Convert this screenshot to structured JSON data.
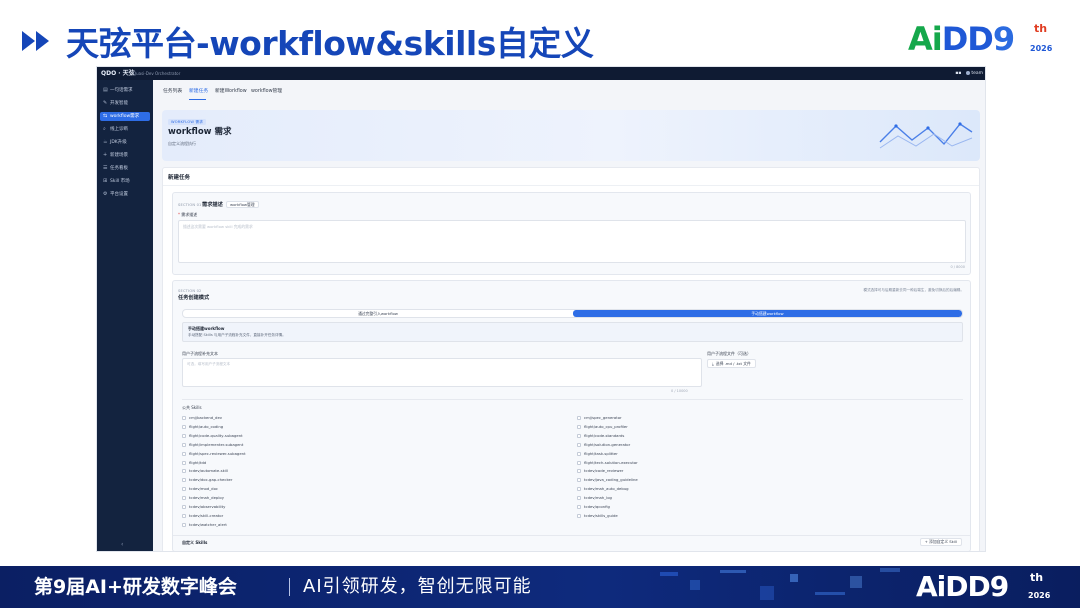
{
  "slide": {
    "title": "天弦平台-workflow&skills自定义",
    "logo": {
      "text_a": "Ai",
      "text_b": "DD",
      "nine": "9",
      "th": "th",
      "year": "2026"
    },
    "footer": {
      "title": "第9届AI+研发数字峰会",
      "slogan": "AI引领研发，智创无限可能"
    },
    "colors": {
      "title": "#1546b8",
      "accent": "#2e6de6",
      "footer_bg": "#0b1f63",
      "sidebar_bg": "#13233f"
    }
  },
  "app": {
    "brand": "QDO · 天弦",
    "brand_sub": "Quasi-Dev Orchestrator",
    "user": "team",
    "sidebar": {
      "items": [
        {
          "icon": "chat-icon",
          "glyph": "▤",
          "label": "一句话需求"
        },
        {
          "icon": "tools-icon",
          "glyph": "✎",
          "label": "开发智能"
        },
        {
          "icon": "workflow-icon",
          "glyph": "⇆",
          "label": "workflow需求"
        },
        {
          "icon": "search-icon",
          "glyph": "⌕",
          "label": "线上诊断"
        },
        {
          "icon": "jdk-icon",
          "glyph": "☕",
          "label": "JDK升级"
        },
        {
          "icon": "plus-icon",
          "glyph": "+",
          "label": "新建场景"
        },
        {
          "icon": "list-icon",
          "glyph": "☰",
          "label": "任务看板"
        },
        {
          "icon": "market-icon",
          "glyph": "⊞",
          "label": "Skill 市场"
        },
        {
          "icon": "settings-icon",
          "glyph": "⚙",
          "label": "平台设置"
        }
      ],
      "active_index": 2,
      "collapse": "‹"
    },
    "tabs": [
      "任务列表",
      "新建任务",
      "新建Workflow",
      "workflow管理"
    ],
    "active_tab": 1,
    "hero": {
      "badge": "WORKFLOW 需求",
      "title": "workflow 需求",
      "subtitle": "自定义流程执行"
    },
    "new_task": {
      "title": "新建任务",
      "section1": {
        "label": "SECTION 01",
        "title": "需求描述",
        "tag": "workflow管理",
        "field_required": "*",
        "field_label": "需求描述",
        "placeholder": "描述这次需要 workflow skill 完成的需求",
        "count": "0 / 8000"
      },
      "section2": {
        "label": "SECTION 02",
        "title": "任务创建模式",
        "hint": "模式选择可与后期重新去同一种后端生，避免切换后的后编辑。",
        "modes": [
          "通过完整引入workflow",
          "手动搭建workflow"
        ],
        "active_mode": 1,
        "info_title": "手动搭建workflow",
        "info_desc": "手动搭配 Skills 与用户子流程补充文件，直接补开任务详情。",
        "req_label": "用户子流程补充文本",
        "req_placeholder": "可选，填写用户子流程文本",
        "req_count": "0 / 10000",
        "file_label": "用户子流程文件（可选）",
        "file_icon": "upload-icon",
        "file_button": "选择 .md / .txt 文件",
        "skills_label": "公共 Skills",
        "skills_left": [
          "cmj/backend_dev",
          "flight/auto_coding",
          "flight/code-quality-subagent",
          "flight/implementer-subagent",
          "flight/spec-reviewer-subagent",
          "flight/tdd",
          "tcdev/automate-skill",
          "tcdev/doc-gap-checker",
          "tcdev/mod_doc",
          "tcdev/mah_deploy",
          "tcdev/observability",
          "tcdev/skill-creator",
          "tcdev/watcher_alert"
        ],
        "skills_right": [
          "cmj/spec_generator",
          "flight/auto_cpu_profiler",
          "flight/code-standards",
          "flight/solution-generator",
          "flight/task-splitter",
          "flight/tech-solution-executor",
          "tcdev/code_reviewer",
          "tcdev/java_coding_guideline",
          "tcdev/mah_auto_debug",
          "tcdev/mah_log",
          "tcdev/qconfig",
          "tcdev/skills_guide"
        ],
        "custom_label": "自定义 Skills",
        "add_skill": "+ 添加自定义 Skill"
      }
    }
  }
}
